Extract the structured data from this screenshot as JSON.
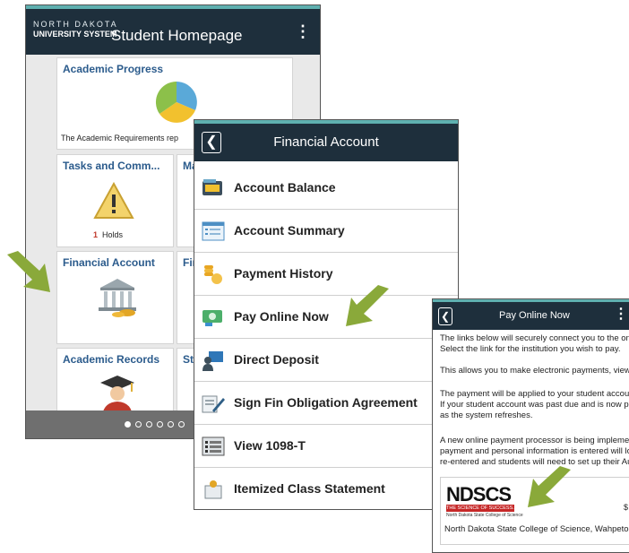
{
  "screen1": {
    "brand_line1": "NORTH DAKOTA",
    "brand_line2": "UNIVERSITY SYSTEM",
    "title": "Student Homepage",
    "tiles": [
      {
        "title": "Academic Progress",
        "caption": "The Academic Requirements rep"
      },
      {
        "title": "Tasks and Comm...",
        "caption": "Holds",
        "count": "1"
      },
      {
        "title": "Ma"
      },
      {
        "title": "Financial Account"
      },
      {
        "title": "Fir"
      },
      {
        "title": "Academic Records"
      },
      {
        "title": "St"
      }
    ],
    "page_dots": 6
  },
  "screen2": {
    "title": "Financial Account",
    "items": [
      {
        "label": "Account Balance",
        "icon": "wallet-icon"
      },
      {
        "label": "Account Summary",
        "icon": "summary-icon"
      },
      {
        "label": "Payment History",
        "icon": "coins-icon"
      },
      {
        "label": "Pay Online Now",
        "icon": "pay-online-icon"
      },
      {
        "label": "Direct Deposit",
        "icon": "direct-deposit-icon"
      },
      {
        "label": "Sign Fin Obligation Agreement",
        "icon": "sign-icon"
      },
      {
        "label": "View 1098-T",
        "icon": "form-icon"
      },
      {
        "label": "Itemized Class Statement",
        "icon": "statement-icon"
      }
    ]
  },
  "screen3": {
    "title": "Pay Online Now",
    "lines": [
      "The links below will securely connect you to the online",
      "Select the link for the institution you wish to pay.",
      "This allows you to make electronic payments, view you",
      "The payment will be applied to your student account in",
      "If your student account was past due and is now paid i",
      "as the system refreshes.",
      "A new online payment processor is being implemented",
      "payment and personal information is entered will look",
      "re-entered and students will need to set up their Autho"
    ],
    "logo_text": "NDSCS",
    "logo_tagline": "THE SCIENCE OF SUCCESS.",
    "logo_subline": "North Dakota State College of Science",
    "institution": "North Dakota State College of Science, Wahpeton",
    "amount_fragment": "$"
  },
  "colors": {
    "header": "#1e2f3c",
    "accent_line": "#5fb0b0",
    "tile_title": "#2b5b8c",
    "arrow": "#8aa93a"
  }
}
